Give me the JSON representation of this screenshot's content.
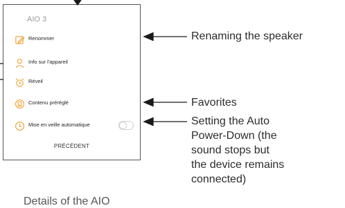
{
  "panel": {
    "title": "AIO 3",
    "items": [
      {
        "label": "Renommer",
        "icon": "pencil-icon"
      },
      {
        "label": "Info sur l'appareil",
        "icon": "person-icon"
      },
      {
        "label": "Réveil",
        "icon": "alarm-clock-icon"
      },
      {
        "label": "Contenu préréglé",
        "icon": "preset-icon"
      },
      {
        "label": "Mise en veille automatique",
        "icon": "power-timer-icon"
      }
    ],
    "back_label": "PRÉCÉDENT",
    "accent_color": "#f0a030"
  },
  "annotations": {
    "rename": "Renaming the speaker",
    "favorites": "Favorites",
    "autopower": [
      "Setting the Auto",
      "Power-Down (the",
      "sound stops but",
      "the device remains",
      "connected)"
    ],
    "bottom_cutoff": "Details of the AIO"
  }
}
